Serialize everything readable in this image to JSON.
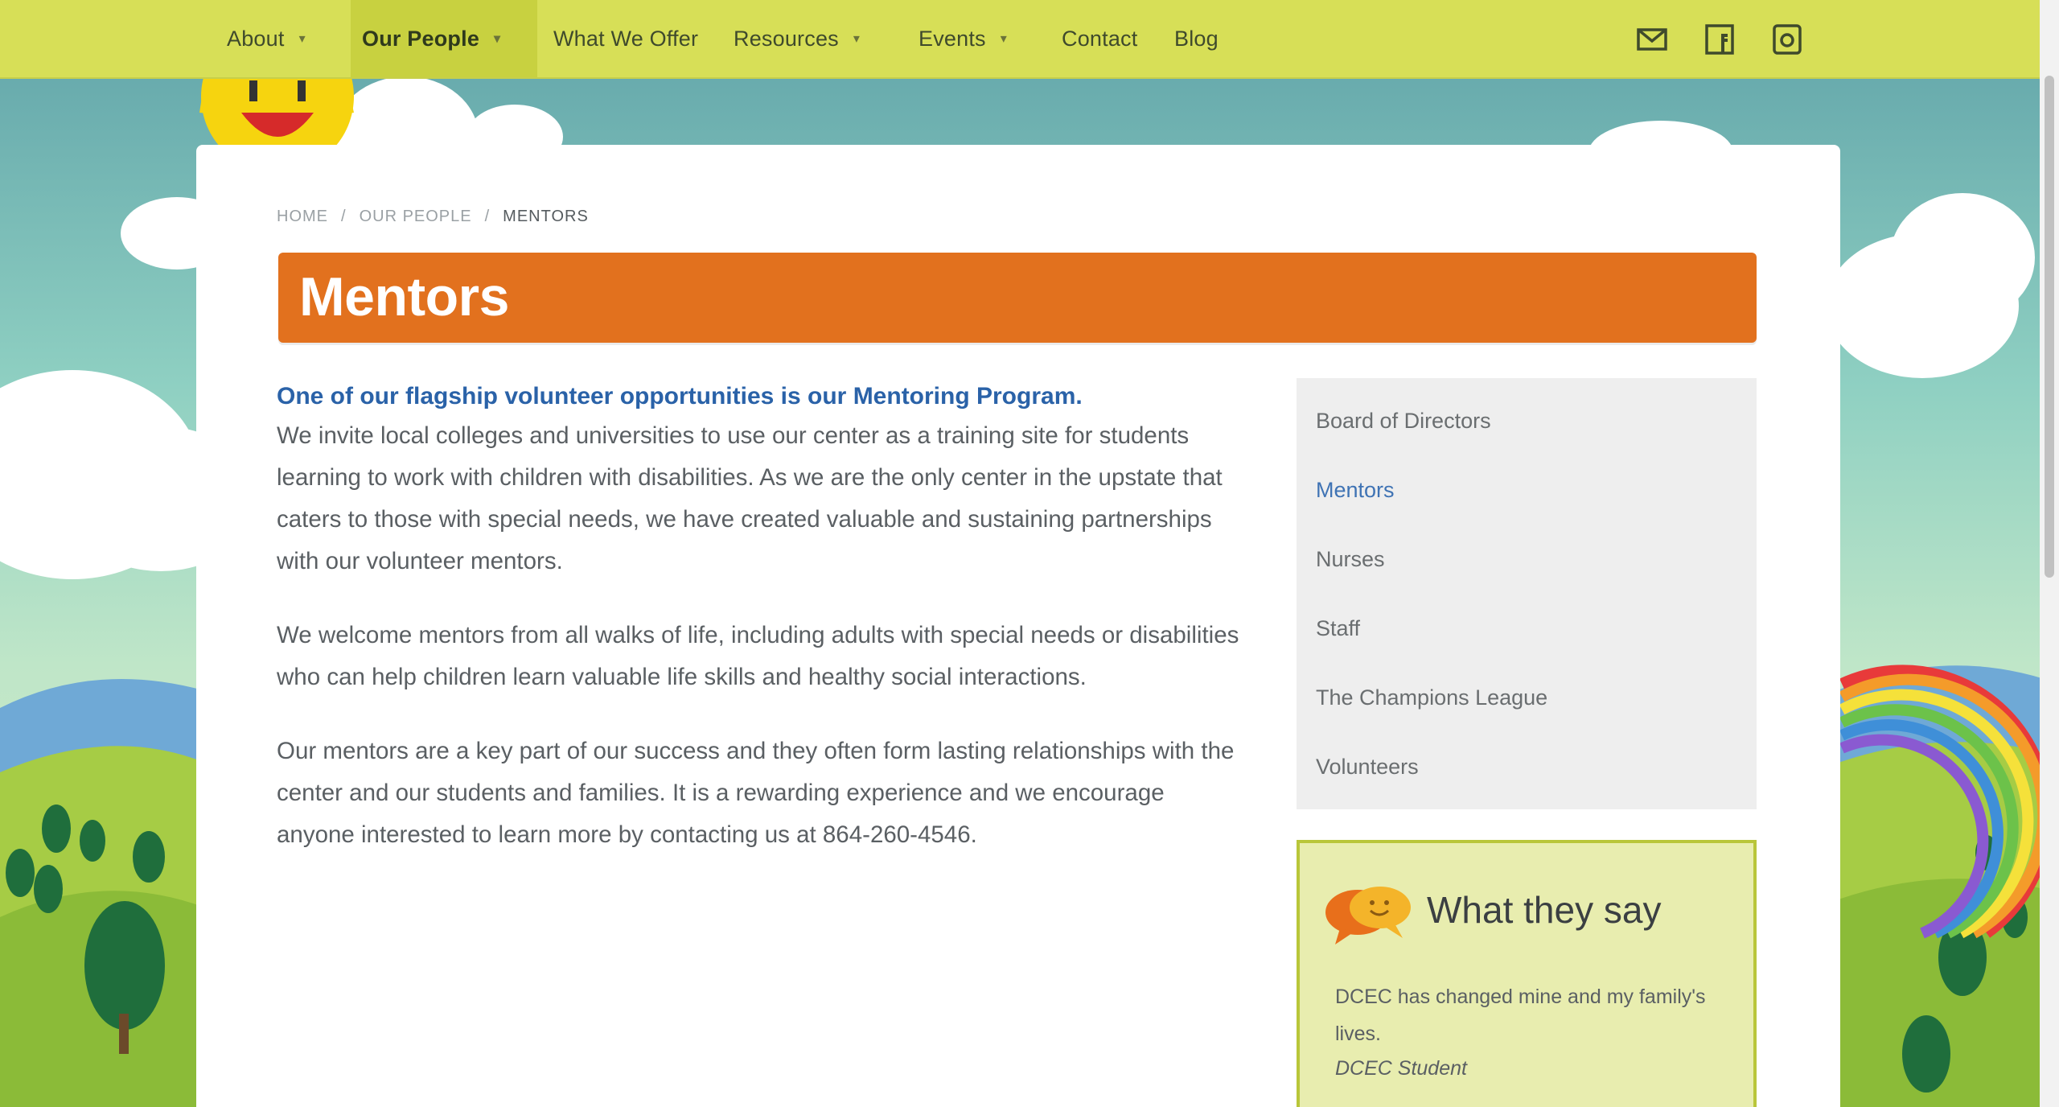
{
  "nav": {
    "items": [
      {
        "label": "About",
        "dropdown": true,
        "active": false
      },
      {
        "label": "Our People",
        "dropdown": true,
        "active": true
      },
      {
        "label": "What We Offer",
        "dropdown": false,
        "active": false
      },
      {
        "label": "Resources",
        "dropdown": true,
        "active": false
      },
      {
        "label": "Events",
        "dropdown": true,
        "active": false
      },
      {
        "label": "Contact",
        "dropdown": false,
        "active": false
      },
      {
        "label": "Blog",
        "dropdown": false,
        "active": false
      }
    ],
    "social_icons": [
      "email-icon",
      "facebook-icon",
      "instagram-icon"
    ]
  },
  "breadcrumb": {
    "items": [
      "HOME",
      "OUR PEOPLE",
      "MENTORS"
    ],
    "separator": "/"
  },
  "page": {
    "title": "Mentors",
    "lead": "One of our flagship volunteer opportunities is our Mentoring Program.",
    "paragraphs": [
      "We invite local colleges and universities to use our center as a training site for students learning to work with children with disabilities. As we are the only center in the upstate that caters to those with special needs, we have created valuable and sustaining partnerships with our volunteer mentors.",
      "We welcome mentors from all walks of life, including adults with special needs or disabilities who can help children learn valuable life skills and healthy social interactions.",
      "Our mentors are a key part of our success and they often form lasting relationships with the center and our students and families. It is a rewarding experience and we encourage anyone interested to learn more by contacting us at 864-260-4546."
    ]
  },
  "sidebar": {
    "items": [
      {
        "label": "Board of Directors",
        "active": false
      },
      {
        "label": "Mentors",
        "active": true
      },
      {
        "label": "Nurses",
        "active": false
      },
      {
        "label": "Staff",
        "active": false
      },
      {
        "label": "The Champions League",
        "active": false
      },
      {
        "label": "Volunteers",
        "active": false
      }
    ]
  },
  "testimonial": {
    "heading": "What they say",
    "icon": "speech-bubbles-icon",
    "quote": "DCEC has changed mine and my family's lives.",
    "author": "DCEC Student"
  },
  "colors": {
    "nav_bg": "#d7df57",
    "title_bar": "#e2711e",
    "link_blue": "#2a62a8",
    "testimonial_bg": "#e8edaf"
  }
}
